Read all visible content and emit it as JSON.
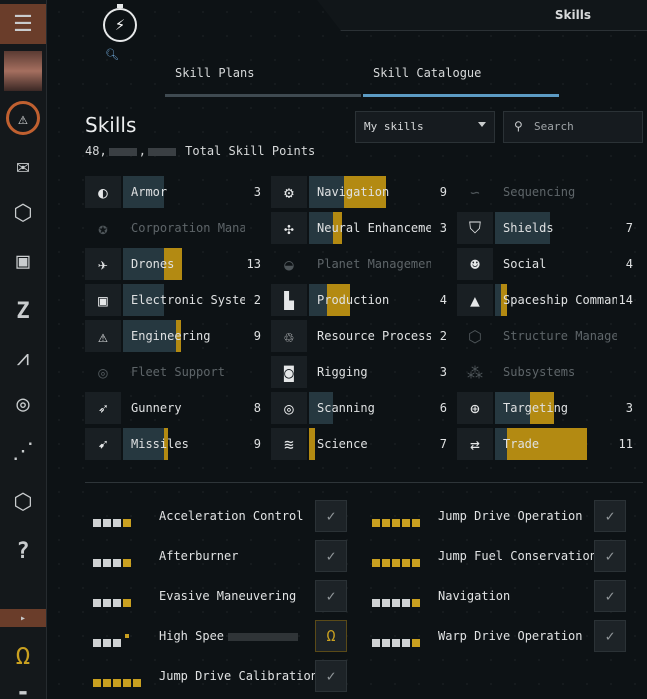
{
  "sidebar": {
    "icons": [
      "menu-icon",
      "character-portrait",
      "warning-icon",
      "mail-icon",
      "inventory-icon",
      "wallet-icon",
      "z-icon",
      "market-chart-icon",
      "industry-icon",
      "map-icon",
      "agency-icon",
      "help-icon",
      "expand-icon",
      "omega-icon"
    ],
    "accent": "#c06030"
  },
  "window": {
    "title": "Skills"
  },
  "tabs": [
    {
      "label": "Skill Plans"
    },
    {
      "label": "Skill Catalogue"
    }
  ],
  "header": {
    "title": "Skills",
    "sp_prefix": "48,",
    "sp_sep": ",",
    "sp_label": "Total Skill Points"
  },
  "filter": {
    "selected": "My skills",
    "search_placeholder": "Search"
  },
  "skill_groups": [
    {
      "name": "Armor",
      "level": "3",
      "col": 0,
      "row": 0,
      "icon": "armor-icon",
      "blue": 0.35,
      "gold": 0
    },
    {
      "name": "Corporation Management",
      "level": "",
      "col": 0,
      "row": 1,
      "icon": "corporation-icon",
      "dim": true
    },
    {
      "name": "Drones",
      "level": "13",
      "col": 0,
      "row": 2,
      "icon": "drone-icon",
      "blue": 0.35,
      "gold": 0.15
    },
    {
      "name": "Electronic Systems",
      "level": "2",
      "col": 0,
      "row": 3,
      "icon": "electronics-icon",
      "blue": 0.35,
      "gold": 0
    },
    {
      "name": "Engineering",
      "level": "9",
      "col": 0,
      "row": 4,
      "icon": "engineering-icon",
      "blue": 0.45,
      "gold": 0.04
    },
    {
      "name": "Fleet Support",
      "level": "",
      "col": 0,
      "row": 5,
      "icon": "fleet-icon",
      "dim": true
    },
    {
      "name": "Gunnery",
      "level": "8",
      "col": 0,
      "row": 6,
      "icon": "gunnery-icon",
      "blue": 0,
      "gold": 0
    },
    {
      "name": "Missiles",
      "level": "9",
      "col": 0,
      "row": 7,
      "icon": "missile-icon",
      "blue": 0.35,
      "gold": 0.03
    },
    {
      "name": "Navigation",
      "level": "9",
      "col": 1,
      "row": 0,
      "icon": "navigation-icon",
      "blue": 0.3,
      "gold": 0.35
    },
    {
      "name": "Neural Enhancement",
      "level": "3",
      "col": 1,
      "row": 1,
      "icon": "neural-icon",
      "blue": 0.2,
      "gold": 0.08
    },
    {
      "name": "Planet Management",
      "level": "",
      "col": 1,
      "row": 2,
      "icon": "planet-icon",
      "dim": true
    },
    {
      "name": "Production",
      "level": "4",
      "col": 1,
      "row": 3,
      "icon": "production-icon",
      "blue": 0.15,
      "gold": 0.2
    },
    {
      "name": "Resource Processing",
      "level": "2",
      "col": 1,
      "row": 4,
      "icon": "resource-icon",
      "blue": 0,
      "gold": 0
    },
    {
      "name": "Rigging",
      "level": "3",
      "col": 1,
      "row": 5,
      "icon": "rigging-icon",
      "blue": 0,
      "gold": 0
    },
    {
      "name": "Scanning",
      "level": "6",
      "col": 1,
      "row": 6,
      "icon": "scanning-icon",
      "blue": 0.2,
      "gold": 0
    },
    {
      "name": "Science",
      "level": "7",
      "col": 1,
      "row": 7,
      "icon": "science-icon",
      "blue": 0,
      "gold": 0.05
    },
    {
      "name": "Sequencing",
      "level": "",
      "col": 2,
      "row": 0,
      "icon": "sequencing-icon",
      "dim": true
    },
    {
      "name": "Shields",
      "level": "7",
      "col": 2,
      "row": 1,
      "icon": "shield-icon",
      "blue": 0.47,
      "gold": 0
    },
    {
      "name": "Social",
      "level": "4",
      "col": 2,
      "row": 2,
      "icon": "social-icon",
      "blue": 0,
      "gold": 0
    },
    {
      "name": "Spaceship Command",
      "level": "14",
      "col": 2,
      "row": 3,
      "icon": "spaceship-icon",
      "blue": 0.05,
      "gold": 0.05
    },
    {
      "name": "Structure Management",
      "level": "",
      "col": 2,
      "row": 4,
      "icon": "structure-icon",
      "dim": true
    },
    {
      "name": "Subsystems",
      "level": "",
      "col": 2,
      "row": 5,
      "icon": "subsystems-icon",
      "dim": true
    },
    {
      "name": "Targeting",
      "level": "3",
      "col": 2,
      "row": 6,
      "icon": "targeting-icon",
      "blue": 0.3,
      "gold": 0.2
    },
    {
      "name": "Trade",
      "level": "11",
      "col": 2,
      "row": 7,
      "icon": "trade-icon",
      "blue": 0.1,
      "gold": 0.68
    }
  ],
  "queue": [
    {
      "name": "Acceleration Control",
      "trained": 3,
      "gold": 1,
      "check": "✓"
    },
    {
      "name": "Afterburner",
      "trained": 3,
      "gold": 1,
      "check": "✓"
    },
    {
      "name": "Evasive Maneuvering",
      "trained": 3,
      "gold": 1,
      "check": "✓"
    },
    {
      "name": "High Speed Maneuvering",
      "trained": 3,
      "gold": 0,
      "partial": true,
      "check": "Ω",
      "omega": true,
      "display": "High Spee"
    },
    {
      "name": "Jump Drive Calibration",
      "trained": 0,
      "gold": 5,
      "check": "✓"
    },
    {
      "name": "Jump Drive Operation",
      "trained": 0,
      "gold": 5,
      "check": "✓"
    },
    {
      "name": "Jump Fuel Conservation",
      "trained": 0,
      "gold": 5,
      "check": "✓"
    },
    {
      "name": "Navigation",
      "trained": 4,
      "gold": 1,
      "check": "✓"
    },
    {
      "name": "Warp Drive Operation",
      "trained": 4,
      "gold": 1,
      "check": "✓"
    }
  ]
}
